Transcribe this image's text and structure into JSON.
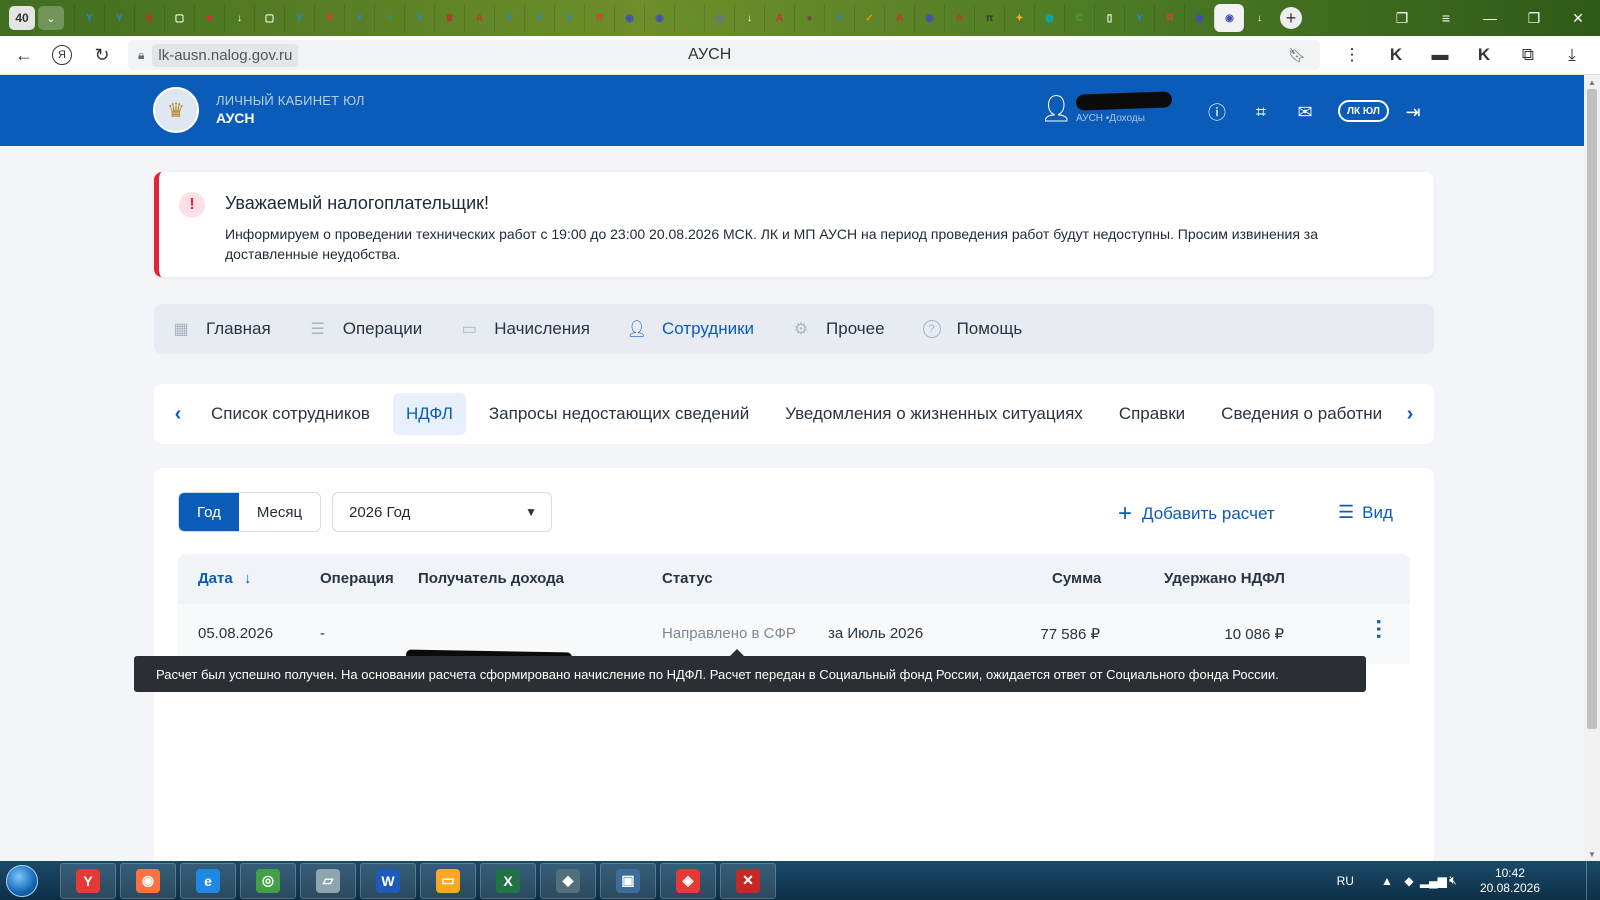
{
  "browser": {
    "tab_count": "40",
    "url": "lk-ausn.nalog.gov.ru",
    "tab_title": "АУСН",
    "tab_favicons": [
      {
        "name": "yandex-y-icon",
        "color": "#1e88e5",
        "glyph": "Y"
      },
      {
        "name": "yandex-y-icon",
        "color": "#1e88e5",
        "glyph": "Y"
      },
      {
        "name": "emblem-icon",
        "color": "#b03a2e",
        "glyph": "♛"
      },
      {
        "name": "box-icon",
        "color": "#ffffff",
        "glyph": "▢"
      },
      {
        "name": "flag-icon",
        "color": "#d32f2f",
        "glyph": "■"
      },
      {
        "name": "download-icon",
        "color": "#ffffff",
        "glyph": "↓"
      },
      {
        "name": "box-icon",
        "color": "#ffffff",
        "glyph": "▢"
      },
      {
        "name": "yandex-y-icon",
        "color": "#1e88e5",
        "glyph": "Y"
      },
      {
        "name": "yandex-ya-icon",
        "color": "#e53935",
        "glyph": "Я"
      },
      {
        "name": "yandex-y-icon",
        "color": "#1e88e5",
        "glyph": "Y"
      },
      {
        "name": "list-icon",
        "color": "#1e88e5",
        "glyph": "≡"
      },
      {
        "name": "yandex-y-icon",
        "color": "#1e88e5",
        "glyph": "Y"
      },
      {
        "name": "emblem-icon",
        "color": "#b03a2e",
        "glyph": "♛"
      },
      {
        "name": "pdf-icon",
        "color": "#d32f2f",
        "glyph": "A"
      },
      {
        "name": "yandex-y-icon",
        "color": "#1e88e5",
        "glyph": "Y"
      },
      {
        "name": "yandex-y-icon",
        "color": "#1e88e5",
        "glyph": "Y"
      },
      {
        "name": "yandex-y-icon",
        "color": "#1e88e5",
        "glyph": "Y"
      },
      {
        "name": "yandex-ya-icon",
        "color": "#e53935",
        "glyph": "Я"
      },
      {
        "name": "nalog-icon",
        "color": "#3f51b5",
        "glyph": "◉"
      },
      {
        "name": "nalog-icon",
        "color": "#3f51b5",
        "glyph": "◉"
      },
      {
        "name": "circle-icon",
        "color": "#43a047",
        "glyph": "C"
      },
      {
        "name": "chat-icon",
        "color": "#5c6bc0",
        "glyph": "◎"
      },
      {
        "name": "download-icon",
        "color": "#ffffff",
        "glyph": "↓"
      },
      {
        "name": "pdf-icon",
        "color": "#d32f2f",
        "glyph": "A"
      },
      {
        "name": "photo-icon",
        "color": "#6d4c41",
        "glyph": "●"
      },
      {
        "name": "yandex-y-icon",
        "color": "#1e88e5",
        "glyph": "Y"
      },
      {
        "name": "orange-icon",
        "color": "#fb8c00",
        "glyph": "✓"
      },
      {
        "name": "pdf-icon",
        "color": "#d32f2f",
        "glyph": "A"
      },
      {
        "name": "nalog-icon",
        "color": "#3f51b5",
        "glyph": "◉"
      },
      {
        "name": "pdf-icon",
        "color": "#d32f2f",
        "glyph": "A"
      },
      {
        "name": "pi-icon",
        "color": "#333333",
        "glyph": "π"
      },
      {
        "name": "star-icon",
        "color": "#f9a825",
        "glyph": "✦"
      },
      {
        "name": "teal-icon",
        "color": "#00acc1",
        "glyph": "◍"
      },
      {
        "name": "circle-icon",
        "color": "#43a047",
        "glyph": "C"
      },
      {
        "name": "doc-icon",
        "color": "#ffffff",
        "glyph": "▯"
      },
      {
        "name": "yandex-y-icon",
        "color": "#1e88e5",
        "glyph": "Y"
      },
      {
        "name": "yandex-ya-icon",
        "color": "#e53935",
        "glyph": "Я"
      },
      {
        "name": "nalog-icon",
        "color": "#3f51b5",
        "glyph": "◉"
      },
      {
        "name": "nalog-icon",
        "color": "#3f51b5",
        "glyph": "◉",
        "active": true
      },
      {
        "name": "download-icon",
        "color": "#ffffff",
        "glyph": "↓"
      }
    ]
  },
  "header": {
    "brand_line1": "ЛИЧНЫЙ КАБИНЕТ ЮЛ",
    "brand_line2": "АУСН",
    "user_mode": "АУСН •Доходы",
    "lk_label": "ЛК ЮЛ"
  },
  "notice": {
    "title": "Уважаемый налогоплательщик!",
    "text": "Информируем о проведении технических работ с 19:00 до 23:00 20.08.2026 МСК. ЛК и МП АУСН на период проведения работ будут недоступны. Просим извинения за доставленные неудобства."
  },
  "main_nav": [
    {
      "label": "Главная",
      "icon": "dashboard-icon"
    },
    {
      "label": "Операции",
      "icon": "operations-icon"
    },
    {
      "label": "Начисления",
      "icon": "accruals-icon"
    },
    {
      "label": "Сотрудники",
      "icon": "employees-icon",
      "active": true
    },
    {
      "label": "Прочее",
      "icon": "gear-icon"
    },
    {
      "label": "Помощь",
      "icon": "help-icon"
    }
  ],
  "sub_tabs": [
    {
      "label": "Список сотрудников"
    },
    {
      "label": "НДФЛ",
      "active": true
    },
    {
      "label": "Запросы недостающих сведений"
    },
    {
      "label": "Уведомления о жизненных ситуациях"
    },
    {
      "label": "Справки"
    },
    {
      "label": "Сведения о работни"
    }
  ],
  "filters": {
    "period_year": "Год",
    "period_month": "Месяц",
    "year_value": "2026 Год",
    "add_label": "Добавить расчет",
    "view_label": "Вид"
  },
  "table": {
    "headers": {
      "date": "Дата",
      "operation": "Операция",
      "recipient": "Получатель дохода",
      "status": "Статус",
      "amount": "Сумма",
      "withheld": "Удержано НДФЛ"
    },
    "rows": [
      {
        "date": "05.08.2026",
        "operation": "-",
        "status": "Направлено в СФР",
        "period": "за Июль 2026",
        "amount": "77 586 ₽",
        "withheld": "10 086 ₽"
      }
    ]
  },
  "tooltip": "Расчет был успешно получен. На основании расчета сформировано начисление по НДФЛ. Расчет передан в Социальный фонд России, ожидается ответ от Социального фонда России.",
  "taskbar": {
    "apps": [
      {
        "name": "yandex-browser-icon",
        "color": "#e53935",
        "glyph": "Y"
      },
      {
        "name": "firefox-icon",
        "color": "#ff7043",
        "glyph": "◉"
      },
      {
        "name": "ie-icon",
        "color": "#1e88e5",
        "glyph": "e"
      },
      {
        "name": "chrome-icon",
        "color": "#43a047",
        "glyph": "◎"
      },
      {
        "name": "notepad-icon",
        "color": "#90a4ae",
        "glyph": "▱"
      },
      {
        "name": "word-icon",
        "color": "#1e5bb8",
        "glyph": "W"
      },
      {
        "name": "explorer-icon",
        "color": "#f9a825",
        "glyph": "▭"
      },
      {
        "name": "excel-icon",
        "color": "#217346",
        "glyph": "X"
      },
      {
        "name": "app-icon",
        "color": "#546e7a",
        "glyph": "◆"
      },
      {
        "name": "remote-icon",
        "color": "#3d6d9c",
        "glyph": "▣"
      },
      {
        "name": "anydesk-icon",
        "color": "#e53935",
        "glyph": "◈"
      },
      {
        "name": "app-red-icon",
        "color": "#c62828",
        "glyph": "✕"
      }
    ],
    "lang": "RU",
    "time": "10:42",
    "date": "20.08.2026"
  }
}
